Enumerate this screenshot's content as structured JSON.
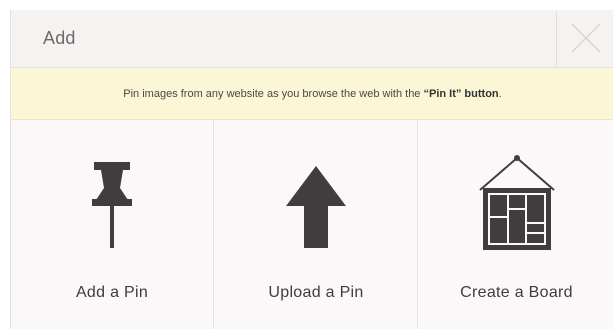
{
  "dialog": {
    "title": "Add",
    "close_icon": "close-x-icon"
  },
  "notice": {
    "text_before": "Pin images from any website as you browse the web with the ",
    "highlight": "“Pin It” button",
    "text_after": "."
  },
  "options": [
    {
      "label": "Add a Pin",
      "icon": "pushpin-icon"
    },
    {
      "label": "Upload a Pin",
      "icon": "upload-arrow-icon"
    },
    {
      "label": "Create a Board",
      "icon": "board-frame-icon"
    }
  ],
  "colors": {
    "icon": "#3f3d3d",
    "notice_bg": "#fbf7d6",
    "header_bg": "#f5f2f2"
  }
}
